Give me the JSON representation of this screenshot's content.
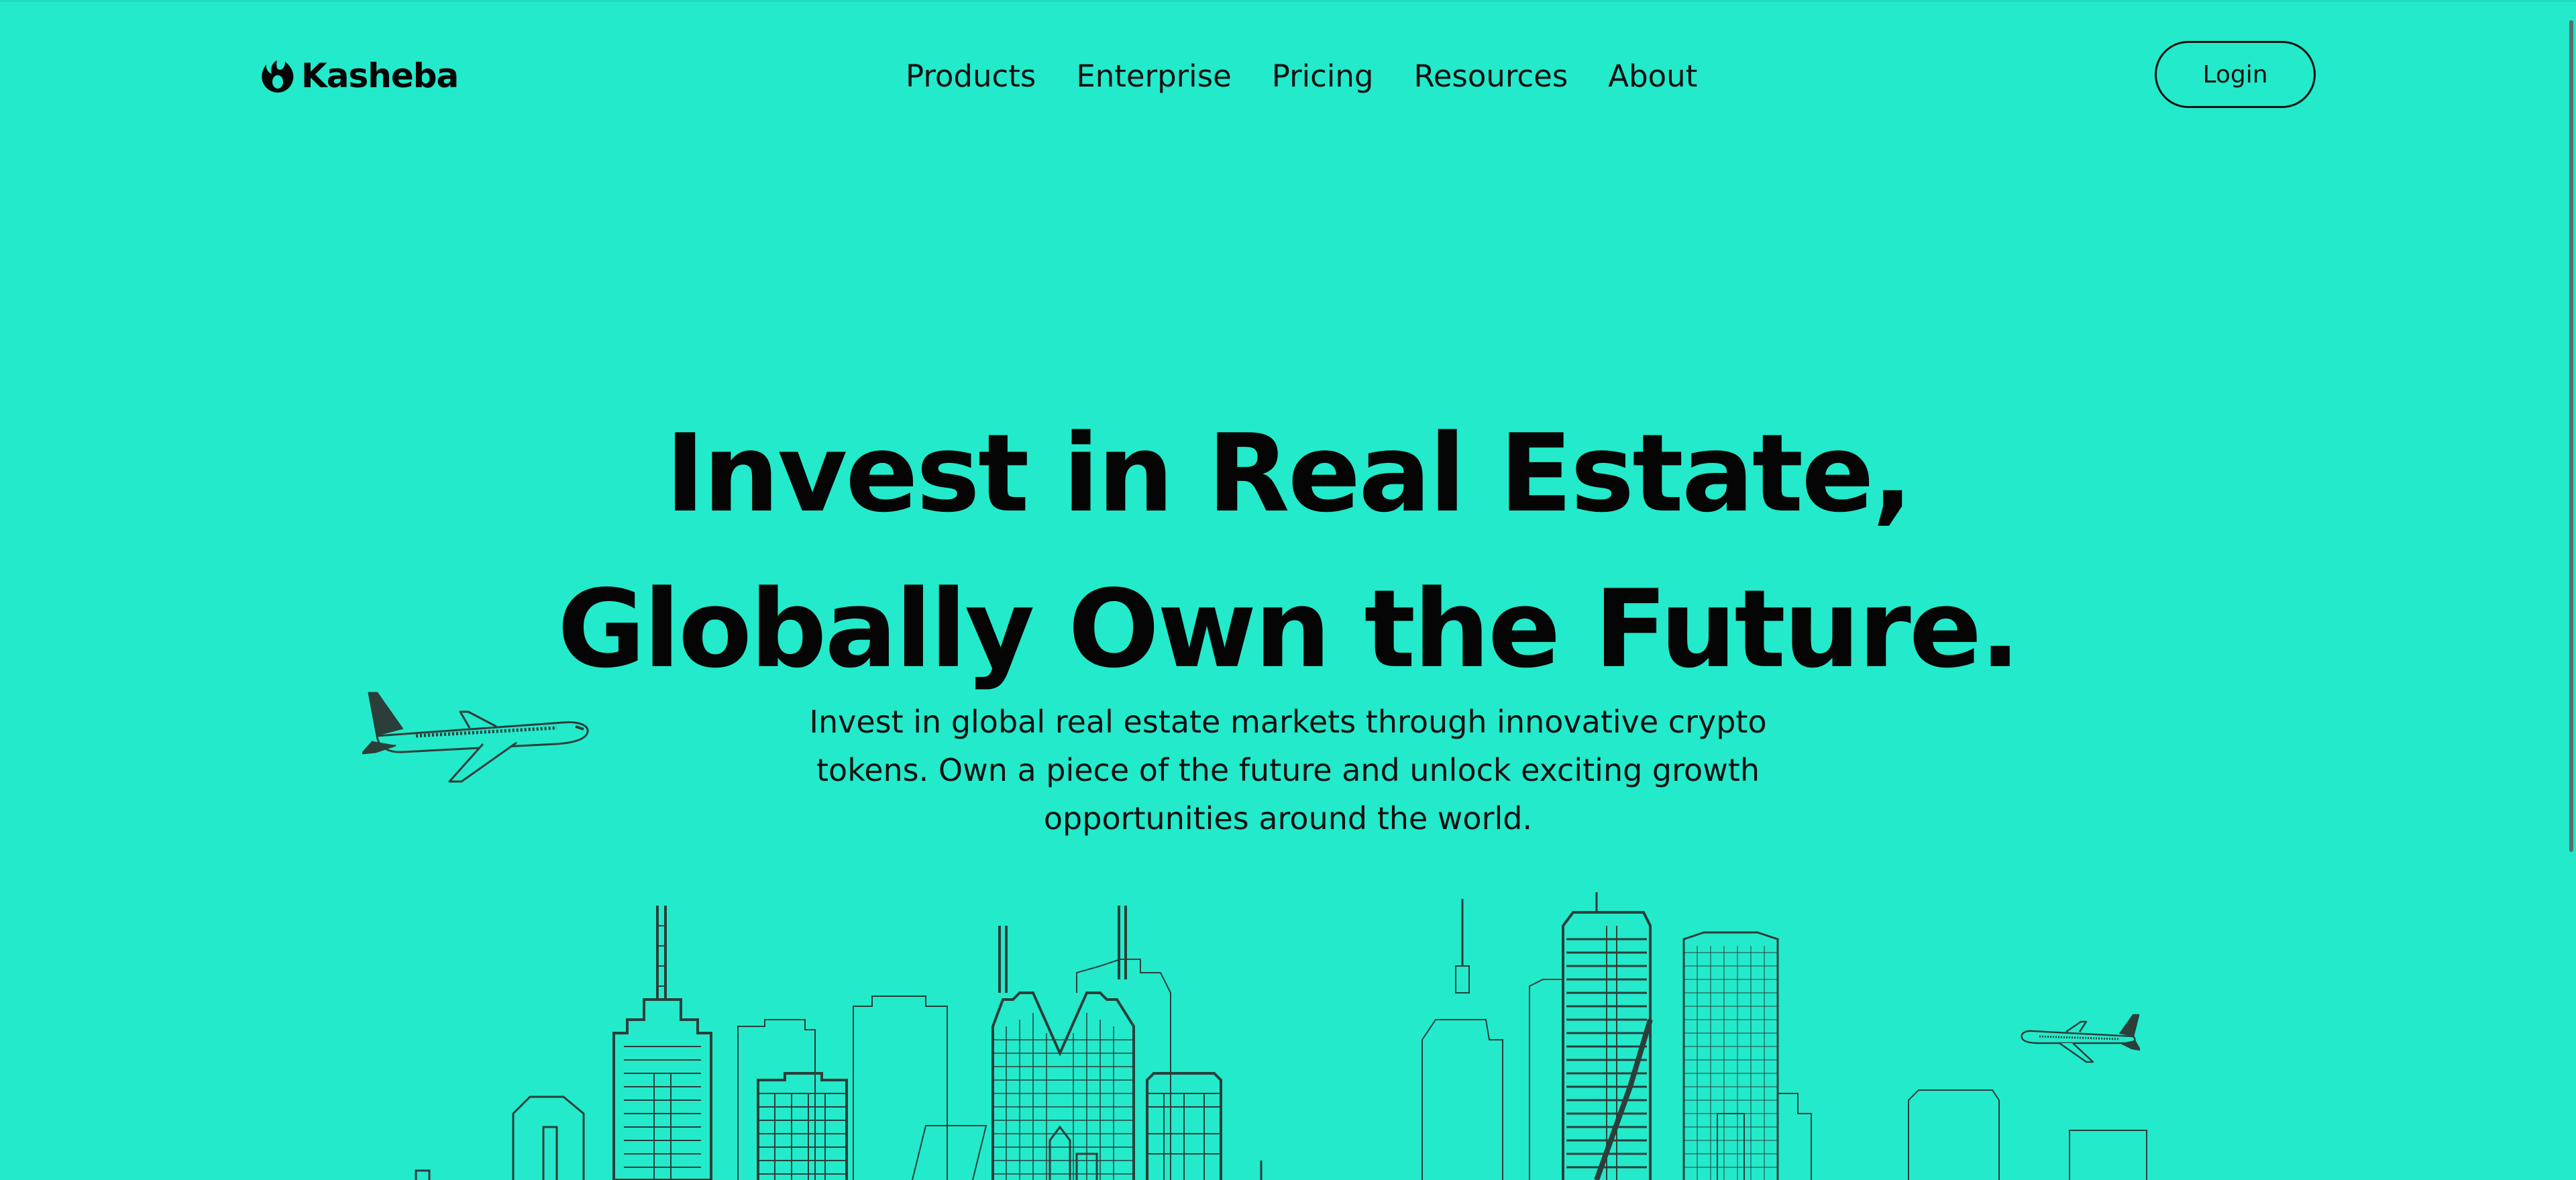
{
  "brand": {
    "name": "Kasheba",
    "logo_icon": "droplet-logo-icon"
  },
  "nav": {
    "items": [
      {
        "label": "Products"
      },
      {
        "label": "Enterprise"
      },
      {
        "label": "Pricing"
      },
      {
        "label": "Resources"
      },
      {
        "label": "About"
      }
    ]
  },
  "header": {
    "login_label": "Login"
  },
  "hero": {
    "title_line1": "Invest in Real Estate,",
    "title_line2": "Globally Own the Future.",
    "subtitle": "Invest in global real estate markets through innovative crypto tokens. Own a piece of the future and unlock exciting growth opportunities around the world."
  },
  "illustrations": {
    "left": "airplane-icon",
    "right": "airplane-icon",
    "bottom": "city-skyline-icon"
  },
  "colors": {
    "background": "#23EACB",
    "text": "#050505",
    "line_art": "#2c3e3a"
  }
}
